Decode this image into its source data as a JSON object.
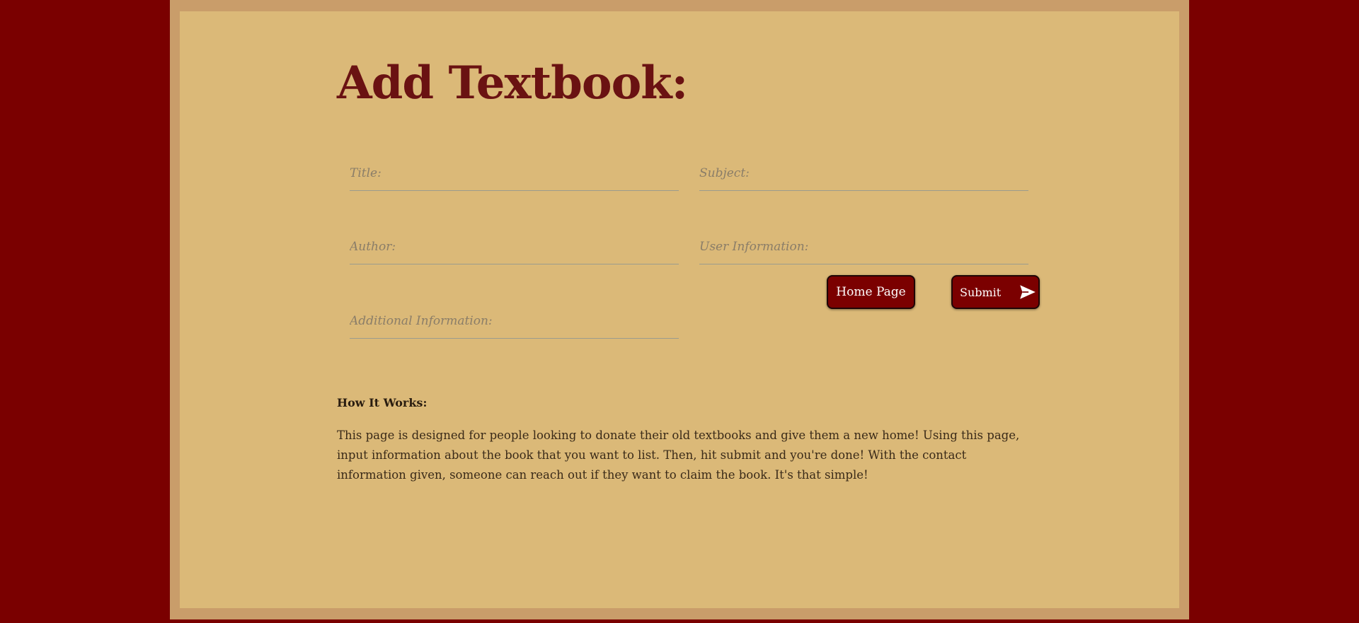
{
  "page": {
    "title": "Add Textbook:"
  },
  "form": {
    "title_placeholder": "Title:",
    "subject_placeholder": "Subject:",
    "author_placeholder": "Author:",
    "user_info_placeholder": "User Information:",
    "additional_info_placeholder": "Additional Information:"
  },
  "buttons": {
    "home_label": "Home Page",
    "submit_label": "Submit",
    "submit_icon": "send-icon"
  },
  "info": {
    "heading": "How It Works:",
    "body": "This page is designed for people looking to donate their old textbooks and give them a new home! Using this page, input information about the book that you want to list. Then, hit submit and you're done! With the contact information given, someone can reach out if they want to claim the book. It's that simple!"
  },
  "colors": {
    "background": "#7a0000",
    "frame": "#c99d6a",
    "panel": "#dbb978",
    "title": "#6a1212",
    "button": "#7b0000"
  }
}
